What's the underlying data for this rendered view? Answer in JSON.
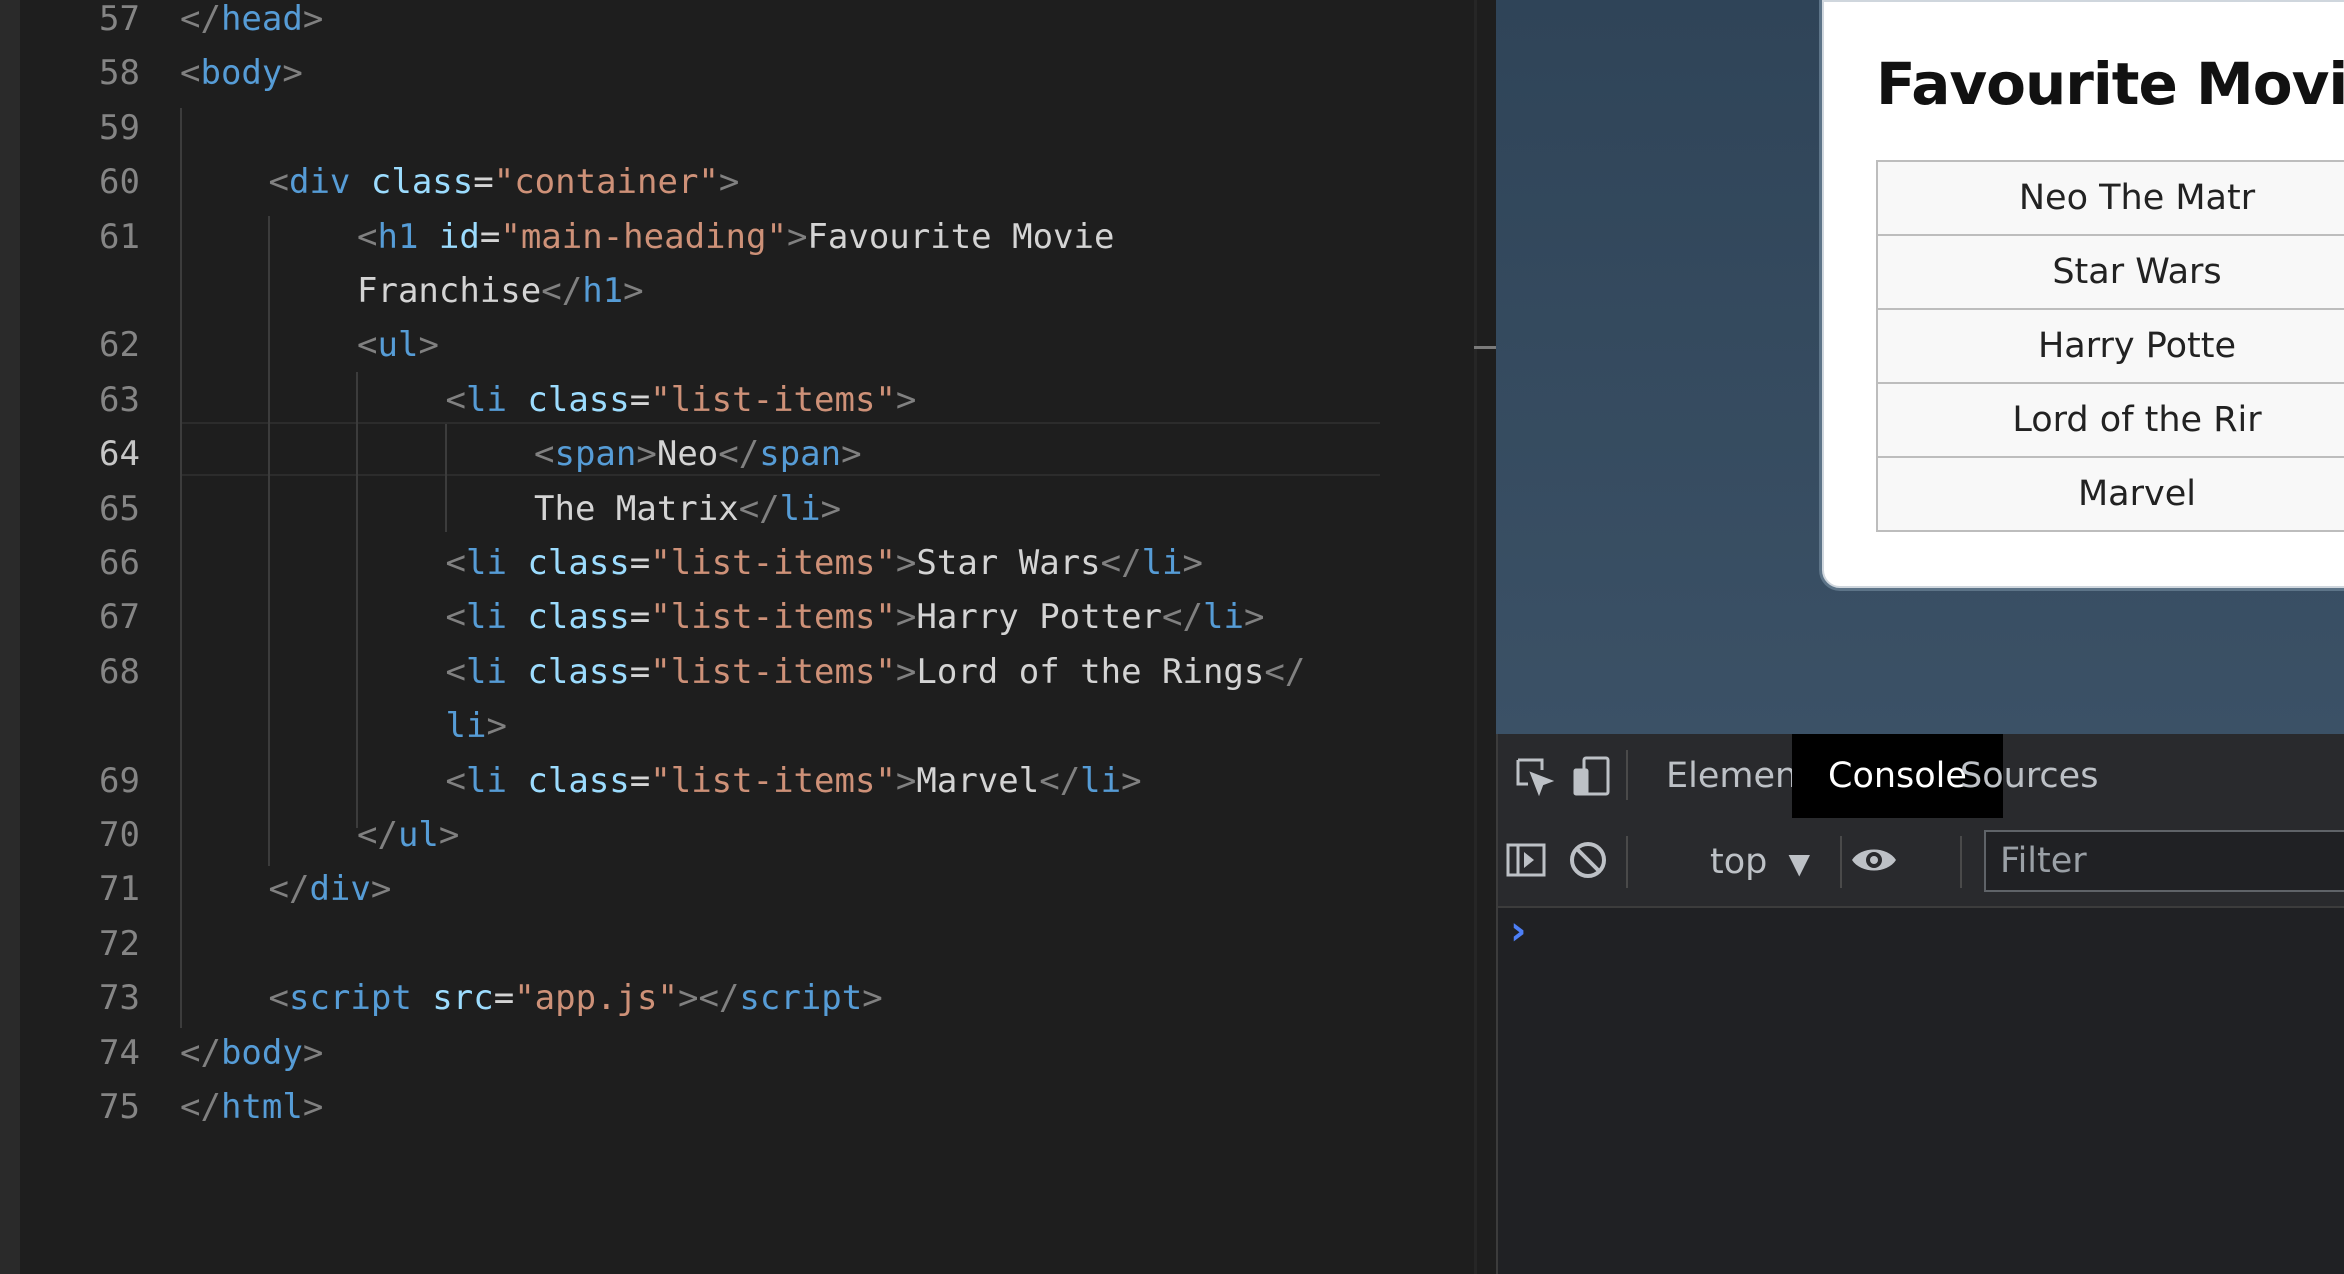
{
  "editor": {
    "lines": [
      {
        "num": "57",
        "segments": [
          [
            "p",
            "</"
          ],
          [
            "t",
            "head"
          ],
          [
            "p",
            ">"
          ]
        ]
      },
      {
        "num": "58",
        "segments": [
          [
            "p",
            "<"
          ],
          [
            "t",
            "body"
          ],
          [
            "p",
            ">"
          ]
        ]
      },
      {
        "num": "59",
        "segments": []
      },
      {
        "num": "60",
        "segments": [
          [
            "p",
            "<"
          ],
          [
            "t",
            "div"
          ],
          [
            "x",
            " "
          ],
          [
            "a",
            "class"
          ],
          [
            "x",
            "="
          ],
          [
            "s",
            "\"container\""
          ],
          [
            "p",
            ">"
          ]
        ]
      },
      {
        "num": "61",
        "segments": [
          [
            "p",
            "<"
          ],
          [
            "t",
            "h1"
          ],
          [
            "x",
            " "
          ],
          [
            "a",
            "id"
          ],
          [
            "x",
            "="
          ],
          [
            "s",
            "\"main-heading\""
          ],
          [
            "p",
            ">"
          ],
          [
            "x",
            "Favourite Movie"
          ]
        ]
      },
      {
        "num": "",
        "segments": [
          [
            "x",
            "Franchise"
          ],
          [
            "p",
            "</"
          ],
          [
            "t",
            "h1"
          ],
          [
            "p",
            ">"
          ]
        ]
      },
      {
        "num": "62",
        "segments": [
          [
            "p",
            "<"
          ],
          [
            "t",
            "ul"
          ],
          [
            "p",
            ">"
          ]
        ]
      },
      {
        "num": "63",
        "segments": [
          [
            "p",
            "<"
          ],
          [
            "t",
            "li"
          ],
          [
            "x",
            " "
          ],
          [
            "a",
            "class"
          ],
          [
            "x",
            "="
          ],
          [
            "s",
            "\"list-items\""
          ],
          [
            "p",
            ">"
          ]
        ]
      },
      {
        "num": "64",
        "segments": [
          [
            "p",
            "<"
          ],
          [
            "t",
            "span"
          ],
          [
            "p",
            ">"
          ],
          [
            "x",
            "Neo"
          ],
          [
            "p",
            "</"
          ],
          [
            "t",
            "span"
          ],
          [
            "p",
            ">"
          ]
        ]
      },
      {
        "num": "65",
        "segments": [
          [
            "x",
            "The Matrix"
          ],
          [
            "p",
            "</"
          ],
          [
            "t",
            "li"
          ],
          [
            "p",
            ">"
          ]
        ]
      },
      {
        "num": "66",
        "segments": [
          [
            "p",
            "<"
          ],
          [
            "t",
            "li"
          ],
          [
            "x",
            " "
          ],
          [
            "a",
            "class"
          ],
          [
            "x",
            "="
          ],
          [
            "s",
            "\"list-items\""
          ],
          [
            "p",
            ">"
          ],
          [
            "x",
            "Star Wars"
          ],
          [
            "p",
            "</"
          ],
          [
            "t",
            "li"
          ],
          [
            "p",
            ">"
          ]
        ]
      },
      {
        "num": "67",
        "segments": [
          [
            "p",
            "<"
          ],
          [
            "t",
            "li"
          ],
          [
            "x",
            " "
          ],
          [
            "a",
            "class"
          ],
          [
            "x",
            "="
          ],
          [
            "s",
            "\"list-items\""
          ],
          [
            "p",
            ">"
          ],
          [
            "x",
            "Harry Potter"
          ],
          [
            "p",
            "</"
          ],
          [
            "t",
            "li"
          ],
          [
            "p",
            ">"
          ]
        ]
      },
      {
        "num": "68",
        "segments": [
          [
            "p",
            "<"
          ],
          [
            "t",
            "li"
          ],
          [
            "x",
            " "
          ],
          [
            "a",
            "class"
          ],
          [
            "x",
            "="
          ],
          [
            "s",
            "\"list-items\""
          ],
          [
            "p",
            ">"
          ],
          [
            "x",
            "Lord of the Rings"
          ],
          [
            "p",
            "</"
          ]
        ]
      },
      {
        "num": "",
        "segments": [
          [
            "t",
            "li"
          ],
          [
            "p",
            ">"
          ]
        ]
      },
      {
        "num": "69",
        "segments": [
          [
            "p",
            "<"
          ],
          [
            "t",
            "li"
          ],
          [
            "x",
            " "
          ],
          [
            "a",
            "class"
          ],
          [
            "x",
            "="
          ],
          [
            "s",
            "\"list-items\""
          ],
          [
            "p",
            ">"
          ],
          [
            "x",
            "Marvel"
          ],
          [
            "p",
            "</"
          ],
          [
            "t",
            "li"
          ],
          [
            "p",
            ">"
          ]
        ]
      },
      {
        "num": "70",
        "segments": [
          [
            "p",
            "</"
          ],
          [
            "t",
            "ul"
          ],
          [
            "p",
            ">"
          ]
        ]
      },
      {
        "num": "71",
        "segments": [
          [
            "p",
            "</"
          ],
          [
            "t",
            "div"
          ],
          [
            "p",
            ">"
          ]
        ]
      },
      {
        "num": "72",
        "segments": []
      },
      {
        "num": "73",
        "segments": [
          [
            "p",
            "<"
          ],
          [
            "t",
            "script"
          ],
          [
            "x",
            " "
          ],
          [
            "a",
            "src"
          ],
          [
            "x",
            "="
          ],
          [
            "s",
            "\"app.js\""
          ],
          [
            "p",
            "></"
          ],
          [
            "t",
            "script"
          ],
          [
            "p",
            ">"
          ]
        ]
      },
      {
        "num": "74",
        "segments": [
          [
            "p",
            "</"
          ],
          [
            "t",
            "body"
          ],
          [
            "p",
            ">"
          ]
        ]
      },
      {
        "num": "75",
        "segments": [
          [
            "p",
            "</"
          ],
          [
            "t",
            "html"
          ],
          [
            "p",
            ">"
          ]
        ]
      }
    ],
    "active_line": "64"
  },
  "preview": {
    "heading": "Favourite Movie",
    "items": [
      "Neo The Matr",
      "Star Wars",
      "Harry Potte",
      "Lord of the Rir",
      "Marvel"
    ]
  },
  "devtools": {
    "tabs": [
      {
        "label": "Elements",
        "active": false
      },
      {
        "label": "Console",
        "active": true
      },
      {
        "label": "Sources",
        "active": false
      }
    ],
    "context": "top",
    "filter_placeholder": "Filter",
    "prompt": "›",
    "icons": [
      "inspect-element-icon",
      "device-toolbar-icon",
      "sidebar-toggle-icon",
      "clear-console-icon",
      "live-expression-eye-icon"
    ]
  }
}
